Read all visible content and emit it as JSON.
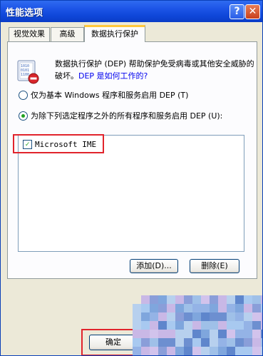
{
  "window": {
    "title": "性能选项",
    "help_glyph": "?",
    "close_glyph": "✕"
  },
  "tabs": [
    {
      "label": "视觉效果"
    },
    {
      "label": "高级"
    },
    {
      "label": "数据执行保护",
      "selected": true
    }
  ],
  "dep": {
    "description": "数据执行保护 (DEP) 帮助保护免受病毒或其他安全威胁的破坏。",
    "link": "DEP 是如何工作的?"
  },
  "options": {
    "essential_only": {
      "label": "仅为基本 Windows 程序和服务启用 DEP (T)",
      "selected": false
    },
    "all_except": {
      "label": "为除下列选定程序之外的所有程序和服务启用 DEP (U):",
      "selected": true
    }
  },
  "exceptions_list": {
    "items": [
      {
        "label": "Microsoft IME",
        "checked": true
      }
    ]
  },
  "buttons": {
    "add": "添加(D)...",
    "remove": "删除(E)",
    "ok": "确定"
  },
  "colors": {
    "titlebar": "#1e56e8",
    "highlight": "#e1242c",
    "dialog_bg": "#ece9d8",
    "link": "#0000ee"
  },
  "overlay": "pixel-mosaic"
}
